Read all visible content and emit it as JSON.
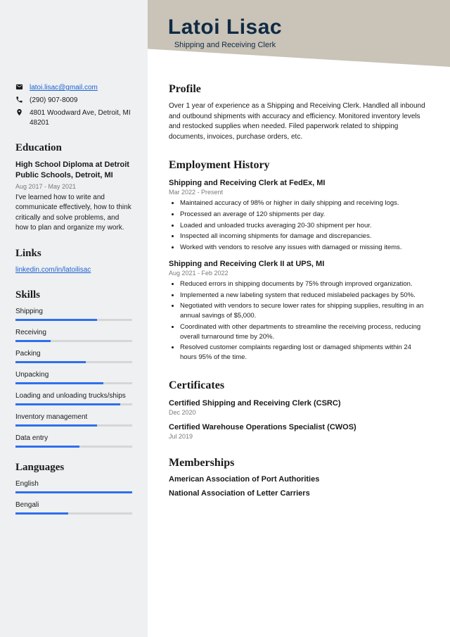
{
  "header": {
    "name": "Latoi Lisac",
    "subtitle": "Shipping and Receiving Clerk"
  },
  "contact": {
    "email": "latoi.lisac@gmail.com",
    "phone": "(290) 907-8009",
    "address": "4801 Woodward Ave, Detroit, MI 48201"
  },
  "education": {
    "heading": "Education",
    "title": "High School Diploma at Detroit Public Schools, Detroit, MI",
    "date": "Aug 2017 - May 2021",
    "desc": "I've learned how to write and communicate effectively, how to think critically and solve problems, and how to plan and organize my work."
  },
  "links": {
    "heading": "Links",
    "items": [
      "linkedin.com/in/latoilisac"
    ]
  },
  "skills": {
    "heading": "Skills",
    "items": [
      {
        "name": "Shipping",
        "pct": 70
      },
      {
        "name": "Receiving",
        "pct": 30
      },
      {
        "name": "Packing",
        "pct": 60
      },
      {
        "name": "Unpacking",
        "pct": 75
      },
      {
        "name": "Loading and unloading trucks/ships",
        "pct": 90
      },
      {
        "name": "Inventory management",
        "pct": 70
      },
      {
        "name": "Data entry",
        "pct": 55
      }
    ]
  },
  "languages": {
    "heading": "Languages",
    "items": [
      {
        "name": "English",
        "pct": 100
      },
      {
        "name": "Bengali",
        "pct": 45
      }
    ]
  },
  "profile": {
    "heading": "Profile",
    "text": "Over 1 year of experience as a Shipping and Receiving Clerk. Handled all inbound and outbound shipments with accuracy and efficiency. Monitored inventory levels and restocked supplies when needed. Filed paperwork related to shipping documents, invoices, purchase orders, etc."
  },
  "employment": {
    "heading": "Employment History",
    "jobs": [
      {
        "title": "Shipping and Receiving Clerk at FedEx, MI",
        "date": "Mar 2022 - Present",
        "bullets": [
          "Maintained accuracy of 98% or higher in daily shipping and receiving logs.",
          "Processed an average of 120 shipments per day.",
          "Loaded and unloaded trucks averaging 20-30 shipment per hour.",
          "Inspected all incoming shipments for damage and discrepancies.",
          "Worked with vendors to resolve any issues with damaged or missing items."
        ]
      },
      {
        "title": "Shipping and Receiving Clerk II at UPS, MI",
        "date": "Aug 2021 - Feb 2022",
        "bullets": [
          "Reduced errors in shipping documents by 75% through improved organization.",
          "Implemented a new labeling system that reduced mislabeled packages by 50%.",
          "Negotiated with vendors to secure lower rates for shipping supplies, resulting in an annual savings of $5,000.",
          "Coordinated with other departments to streamline the receiving process, reducing overall turnaround time by 20%.",
          "Resolved customer complaints regarding lost or damaged shipments within 24 hours 95% of the time."
        ]
      }
    ]
  },
  "certificates": {
    "heading": "Certificates",
    "items": [
      {
        "title": "Certified Shipping and Receiving Clerk (CSRC)",
        "date": "Dec 2020"
      },
      {
        "title": "Certified Warehouse Operations Specialist (CWOS)",
        "date": "Jul 2019"
      }
    ]
  },
  "memberships": {
    "heading": "Memberships",
    "items": [
      "American Association of Port Authorities",
      "National Association of Letter Carriers"
    ]
  }
}
